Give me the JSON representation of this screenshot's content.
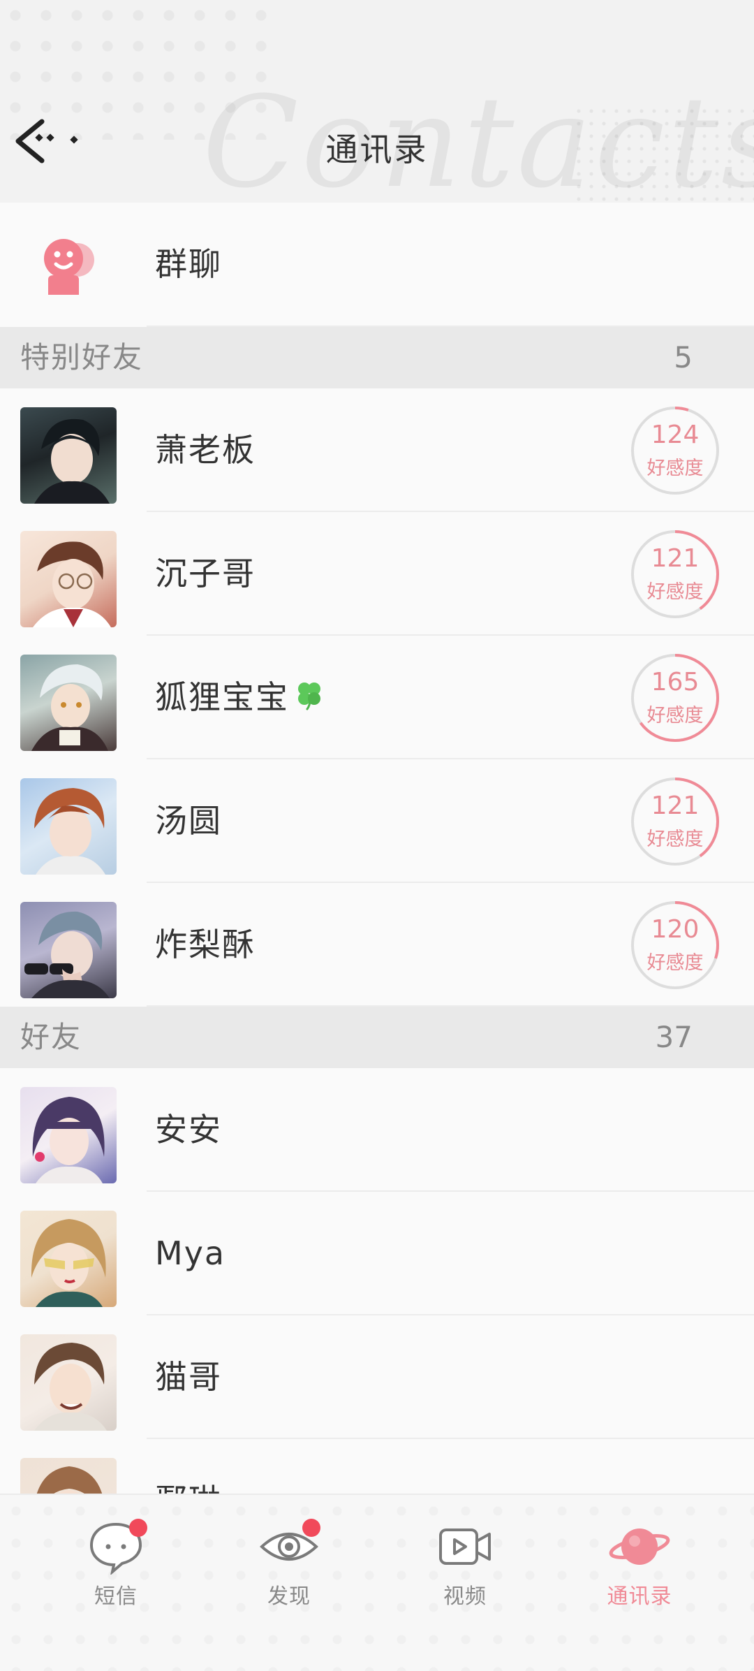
{
  "header": {
    "title": "通讯录",
    "bg_word": "Contacts",
    "back_icon": "back-arrow-icon"
  },
  "group_chat": {
    "label": "群聊",
    "icon": "group-chat-icon"
  },
  "special_friends": {
    "label": "特别好友",
    "count": "5",
    "items": [
      {
        "name": "萧老板",
        "affinity": "124",
        "affinity_label": "好感度",
        "affinity_fraction": 0.05,
        "badge": ""
      },
      {
        "name": "沉子哥",
        "affinity": "121",
        "affinity_label": "好感度",
        "affinity_fraction": 0.4,
        "badge": ""
      },
      {
        "name": "狐狸宝宝",
        "affinity": "165",
        "affinity_label": "好感度",
        "affinity_fraction": 0.65,
        "badge": "clover-icon"
      },
      {
        "name": "汤圆",
        "affinity": "121",
        "affinity_label": "好感度",
        "affinity_fraction": 0.4,
        "badge": ""
      },
      {
        "name": "炸梨酥",
        "affinity": "120",
        "affinity_label": "好感度",
        "affinity_fraction": 0.3,
        "badge": ""
      }
    ]
  },
  "friends": {
    "label": "好友",
    "count": "37",
    "items": [
      {
        "name": "安安"
      },
      {
        "name": "Mya"
      },
      {
        "name": "猫哥"
      },
      {
        "name": "鄢琳"
      }
    ]
  },
  "nav": {
    "items": [
      {
        "label": "短信",
        "icon": "message-bubble-icon",
        "badge": true,
        "active": false
      },
      {
        "label": "发现",
        "icon": "eye-icon",
        "badge": true,
        "active": false
      },
      {
        "label": "视频",
        "icon": "video-camera-icon",
        "badge": false,
        "active": false
      },
      {
        "label": "通讯录",
        "icon": "planet-icon",
        "badge": false,
        "active": true
      }
    ]
  },
  "colors": {
    "accent_pink": "#f08a96",
    "badge_red": "#f1495a",
    "ring_grey": "#dddddd",
    "clover_green": "#5cc85a"
  }
}
